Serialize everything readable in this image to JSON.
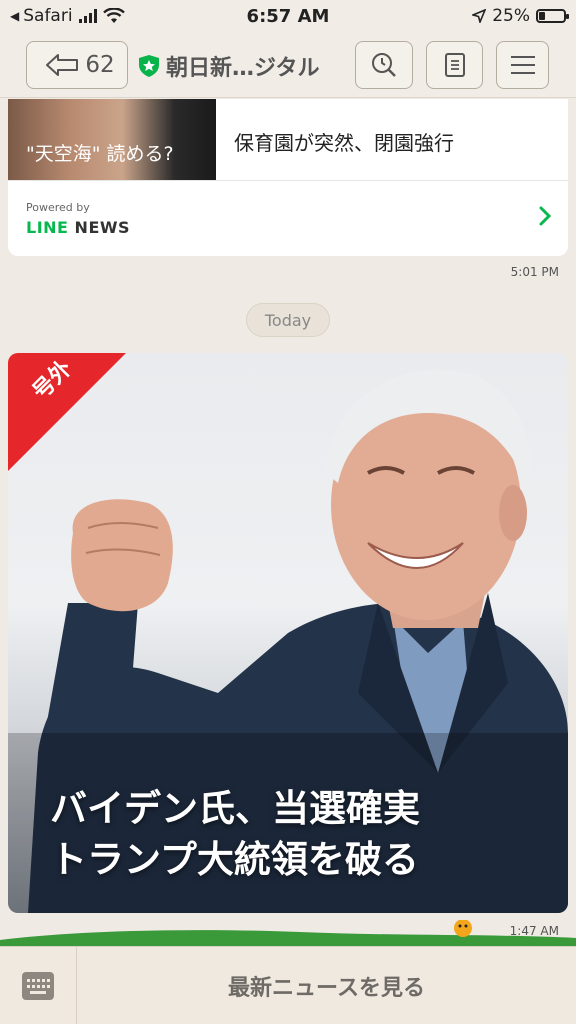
{
  "status_bar": {
    "back_app": "Safari",
    "time": "6:57 AM",
    "battery": "25%",
    "battery_level": 0.25
  },
  "header": {
    "back_count": "62",
    "title": "朝日新…ジタル"
  },
  "previous_card": {
    "thumb_caption": "\"天空海\" 読める?",
    "text": "保育園が突然、閉園強行",
    "powered_by": "Powered by",
    "brand_line": "LINE",
    "brand_news": "NEWS",
    "time": "5:01 PM"
  },
  "divider_label": "Today",
  "news_card": {
    "badge": "号外",
    "headline_line1": "バイデン氏、当選確実",
    "headline_line2": "トランプ大統領を破る",
    "time": "1:47 AM"
  },
  "bottom_bar": {
    "action_label": "最新ニュースを見る"
  },
  "icons": [
    "back-arrow-icon",
    "shield-star-icon",
    "search-icon",
    "document-icon",
    "hamburger-menu-icon",
    "chevron-right-icon",
    "keyboard-icon",
    "location-arrow-icon",
    "wifi-icon",
    "signal-icon",
    "battery-icon"
  ],
  "colors": {
    "accent_green": "#06b84d",
    "badge_red": "#e5262a",
    "background": "#efeae3"
  }
}
